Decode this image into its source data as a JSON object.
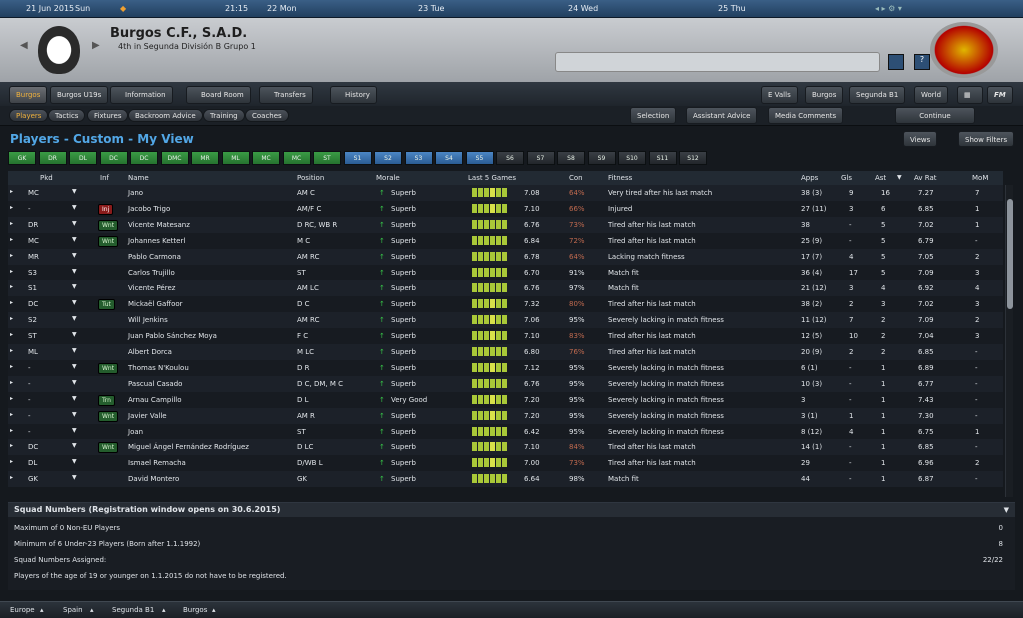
{
  "calendar": {
    "date": "21 Jun 2015",
    "dow": "Sun",
    "time": "21:15",
    "d1": "22 Mon",
    "d2": "23 Tue",
    "d3": "24 Wed",
    "d4": "25 Thu"
  },
  "club": {
    "name": "Burgos C.F., S.A.D.",
    "position": "4th in Segunda División B Grupo 1"
  },
  "nav_tabs": [
    "Burgos",
    "Burgos U19s",
    "Information",
    "Board Room",
    "Transfers",
    "History"
  ],
  "nav_right": [
    "E Valls",
    "Burgos",
    "Segunda B1",
    "World",
    "FM"
  ],
  "sub_tabs": [
    "Players",
    "Tactics",
    "Fixtures",
    "Backroom Advice",
    "Training",
    "Coaches"
  ],
  "sub_right": [
    "Selection",
    "Assistant Advice",
    "Media Comments",
    "Continue"
  ],
  "view_title": "Players - Custom - My View",
  "views_btn": "Views",
  "show_filters": "Show Filters",
  "filters": [
    "GK",
    "DR",
    "DL",
    "DC",
    "DC",
    "DMC",
    "MR",
    "ML",
    "MC",
    "MC",
    "ST",
    "S1",
    "S2",
    "S3",
    "S4",
    "S5",
    "S6",
    "S7",
    "S8",
    "S9",
    "S10",
    "S11",
    "S12"
  ],
  "columns": [
    "Pkd",
    "Inf",
    "Name",
    "Position",
    "Morale",
    "Last 5 Games",
    "Con",
    "Fitness",
    "Apps",
    "Gls",
    "Ast",
    "Av Rat",
    "MoM"
  ],
  "players": [
    {
      "pkd": "MC",
      "inf": "",
      "name": "Jano",
      "pos": "AM C",
      "morale": "Superb",
      "l5": "7.08",
      "con": "64%",
      "fit": "Very tired after his last match",
      "apps": "38 (3)",
      "gls": "9",
      "ast": "16",
      "avr": "7.27",
      "mom": "7"
    },
    {
      "pkd": "-",
      "inf": "Inj",
      "name": "Jacobo Trigo",
      "pos": "AM/F C",
      "morale": "Superb",
      "l5": "7.10",
      "con": "66%",
      "fit": "Injured",
      "apps": "27 (11)",
      "gls": "3",
      "ast": "6",
      "avr": "6.85",
      "mom": "1"
    },
    {
      "pkd": "DR",
      "inf": "Wnt",
      "name": "Vicente Matesanz",
      "pos": "D RC, WB R",
      "morale": "Superb",
      "l5": "6.76",
      "con": "73%",
      "fit": "Tired after his last match",
      "apps": "38",
      "gls": "-",
      "ast": "5",
      "avr": "7.02",
      "mom": "1"
    },
    {
      "pkd": "MC",
      "inf": "Wnt",
      "name": "Johannes Ketterl",
      "pos": "M C",
      "morale": "Superb",
      "l5": "6.84",
      "con": "72%",
      "fit": "Tired after his last match",
      "apps": "25 (9)",
      "gls": "-",
      "ast": "5",
      "avr": "6.79",
      "mom": "-"
    },
    {
      "pkd": "MR",
      "inf": "",
      "name": "Pablo Carmona",
      "pos": "AM RC",
      "morale": "Superb",
      "l5": "6.78",
      "con": "64%",
      "fit": "Lacking match fitness",
      "apps": "17 (7)",
      "gls": "4",
      "ast": "5",
      "avr": "7.05",
      "mom": "2"
    },
    {
      "pkd": "S3",
      "inf": "",
      "name": "Carlos Trujillo",
      "pos": "ST",
      "morale": "Superb",
      "l5": "6.70",
      "con": "91%",
      "fit": "Match fit",
      "apps": "36 (4)",
      "gls": "17",
      "ast": "5",
      "avr": "7.09",
      "mom": "3"
    },
    {
      "pkd": "S1",
      "inf": "",
      "name": "Vicente Pérez",
      "pos": "AM LC",
      "morale": "Superb",
      "l5": "6.76",
      "con": "97%",
      "fit": "Match fit",
      "apps": "21 (12)",
      "gls": "3",
      "ast": "4",
      "avr": "6.92",
      "mom": "4"
    },
    {
      "pkd": "DC",
      "inf": "Tut",
      "name": "Mickaël Gaffoor",
      "pos": "D C",
      "morale": "Superb",
      "l5": "7.32",
      "con": "80%",
      "fit": "Tired after his last match",
      "apps": "38 (2)",
      "gls": "2",
      "ast": "3",
      "avr": "7.02",
      "mom": "3"
    },
    {
      "pkd": "S2",
      "inf": "",
      "name": "Will Jenkins",
      "pos": "AM RC",
      "morale": "Superb",
      "l5": "7.06",
      "con": "95%",
      "fit": "Severely lacking in match fitness",
      "apps": "11 (12)",
      "gls": "7",
      "ast": "2",
      "avr": "7.09",
      "mom": "2"
    },
    {
      "pkd": "ST",
      "inf": "",
      "name": "Juan Pablo Sánchez Moya",
      "pos": "F C",
      "morale": "Superb",
      "l5": "7.10",
      "con": "83%",
      "fit": "Tired after his last match",
      "apps": "12 (5)",
      "gls": "10",
      "ast": "2",
      "avr": "7.04",
      "mom": "3"
    },
    {
      "pkd": "ML",
      "inf": "",
      "name": "Albert Dorca",
      "pos": "M LC",
      "morale": "Superb",
      "l5": "6.80",
      "con": "76%",
      "fit": "Tired after his last match",
      "apps": "20 (9)",
      "gls": "2",
      "ast": "2",
      "avr": "6.85",
      "mom": "-"
    },
    {
      "pkd": "-",
      "inf": "Wnt",
      "name": "Thomas N'Koulou",
      "pos": "D R",
      "morale": "Superb",
      "l5": "7.12",
      "con": "95%",
      "fit": "Severely lacking in match fitness",
      "apps": "6 (1)",
      "gls": "-",
      "ast": "1",
      "avr": "6.89",
      "mom": "-"
    },
    {
      "pkd": "-",
      "inf": "",
      "name": "Pascual Casado",
      "pos": "D C, DM, M C",
      "morale": "Superb",
      "l5": "6.76",
      "con": "95%",
      "fit": "Severely lacking in match fitness",
      "apps": "10 (3)",
      "gls": "-",
      "ast": "1",
      "avr": "6.77",
      "mom": "-"
    },
    {
      "pkd": "-",
      "inf": "Trn",
      "name": "Arnau Campillo",
      "pos": "D L",
      "morale": "Very Good",
      "l5": "7.20",
      "con": "95%",
      "fit": "Severely lacking in match fitness",
      "apps": "3",
      "gls": "-",
      "ast": "1",
      "avr": "7.43",
      "mom": "-"
    },
    {
      "pkd": "-",
      "inf": "Wnt",
      "name": "Javier Valle",
      "pos": "AM R",
      "morale": "Superb",
      "l5": "7.20",
      "con": "95%",
      "fit": "Severely lacking in match fitness",
      "apps": "3 (1)",
      "gls": "1",
      "ast": "1",
      "avr": "7.30",
      "mom": "-"
    },
    {
      "pkd": "-",
      "inf": "",
      "name": "Joan",
      "pos": "ST",
      "morale": "Superb",
      "l5": "6.42",
      "con": "95%",
      "fit": "Severely lacking in match fitness",
      "apps": "8 (12)",
      "gls": "4",
      "ast": "1",
      "avr": "6.75",
      "mom": "1"
    },
    {
      "pkd": "DC",
      "inf": "Wnt",
      "name": "Miguel Ángel Fernández Rodríguez",
      "pos": "D LC",
      "morale": "Superb",
      "l5": "7.10",
      "con": "84%",
      "fit": "Tired after his last match",
      "apps": "14 (1)",
      "gls": "-",
      "ast": "1",
      "avr": "6.85",
      "mom": "-"
    },
    {
      "pkd": "DL",
      "inf": "",
      "name": "Ismael Remacha",
      "pos": "D/WB L",
      "morale": "Superb",
      "l5": "7.00",
      "con": "73%",
      "fit": "Tired after his last match",
      "apps": "29",
      "gls": "-",
      "ast": "1",
      "avr": "6.96",
      "mom": "2"
    },
    {
      "pkd": "GK",
      "inf": "",
      "name": "David Montero",
      "pos": "GK",
      "morale": "Superb",
      "l5": "6.64",
      "con": "98%",
      "fit": "Match fit",
      "apps": "44",
      "gls": "-",
      "ast": "1",
      "avr": "6.87",
      "mom": "-"
    }
  ],
  "squad": {
    "header": "Squad Numbers (Registration window opens on 30.6.2015)",
    "lines": [
      {
        "label": "Maximum of 0 Non-EU Players",
        "value": "0"
      },
      {
        "label": "Minimum of 6 Under-23 Players (Born after 1.1.1992)",
        "value": "8"
      },
      {
        "label": "Squad Numbers Assigned:",
        "value": "22/22"
      },
      {
        "label": "Players of the age of 19 or younger on 1.1.2015 do not have to be registered.",
        "value": ""
      }
    ]
  },
  "footer": [
    "Europe",
    "Spain",
    "Segunda B1",
    "Burgos"
  ]
}
